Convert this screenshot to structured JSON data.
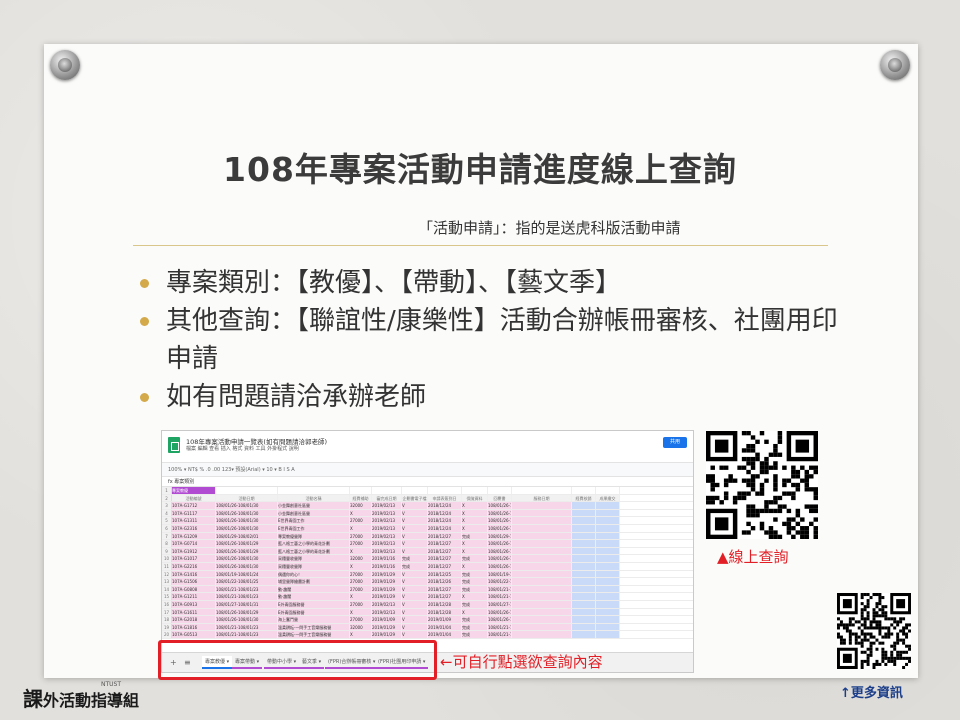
{
  "slide": {
    "title": "108年專案活動申請進度線上查詢",
    "subtitle": "「活動申請」：指的是送虎科版活動申請",
    "bullets": [
      "專案類別：【教優】、【帶動】、【藝文季】",
      "其他查詢：【聯誼性/康樂性】活動合辦帳冊審核、社團用印申請",
      "如有問題請洽承辦老師"
    ]
  },
  "spreadsheet": {
    "doc_title": "108年專案活動申請一覽表(如有問題請洽郭老師)",
    "menu": "檔案  編輯  查看  插入  格式  資料  工具  外掛程式  說明",
    "share_label": "共用",
    "toolbar": "100%  ▾  NT$  %  .0  .00  123▾  預設(Arial) ▾  10 ▾  B  I  S  A",
    "formula": "fx  專案類別",
    "tag": "專案教優",
    "header_row": [
      "活動編號",
      "活動日期",
      "活動名稱",
      "經費補助",
      "審完成日期",
      "企劃書電子檔",
      "申請表簽到日",
      "保險資料",
      "回覆書",
      "服務日期",
      "經費核銷",
      "成果繳交"
    ],
    "rows": [
      [
        "107A-G1712",
        "108/01/26-108/01/30",
        "小金舞創意社區營",
        "32000",
        "2019/02/13",
        "V",
        "2018/12/24",
        "X",
        "108/01/26-108/01/30"
      ],
      [
        "107A-G1117",
        "108/01/26-108/01/30",
        "小金舞創意社區營",
        "X",
        "2019/02/13",
        "V",
        "2018/12/24",
        "X",
        "108/01/26-108/01/30"
      ],
      [
        "107A-G1311",
        "108/01/26-108/01/30",
        "E世界青園工作",
        "27000",
        "2019/02/13",
        "V",
        "2018/12/24",
        "X",
        "108/01/26-108/01/30"
      ],
      [
        "107A-G2316",
        "108/01/26-108/01/30",
        "E世界青園工作",
        "X",
        "2019/02/13",
        "V",
        "2018/12/24",
        "X",
        "108/01/26-108/01/30"
      ],
      [
        "107A-G1209",
        "108/01/29-108/02/01",
        "專案教優營隊",
        "27000",
        "2019/02/13",
        "V",
        "2018/12/27",
        "完成",
        "108/01/29-108/02/01"
      ],
      [
        "107A-G0714",
        "108/01/26-108/01/29",
        "藍八格工藝之小學的青花計劃",
        "27000",
        "2019/02/13",
        "V",
        "2018/12/27",
        "X",
        "108/01/26-108/01/29"
      ],
      [
        "107A-G1912",
        "108/01/26-108/01/29",
        "藍八格工藝之小學的青花計劃",
        "X",
        "2019/02/13",
        "V",
        "2018/12/27",
        "X",
        "108/01/26-108/01/29"
      ],
      [
        "107A-G1017",
        "108/01/26-108/01/30",
        "采穗豐收營隊",
        "32000",
        "2019/01/16",
        "完成",
        "2018/12/27",
        "完成",
        "108/01/26-108/01/30"
      ],
      [
        "107A-G2216",
        "108/01/26-108/01/30",
        "采穗豐收營隊",
        "X",
        "2019/01/16",
        "完成",
        "2018/12/27",
        "X",
        "108/01/26-108/01/30"
      ],
      [
        "107A-G1416",
        "108/01/19-108/01/24",
        "偶遇你的心！",
        "27000",
        "2019/01/29",
        "V",
        "2018/12/25",
        "完成",
        "108/01/19-108/01/24"
      ],
      [
        "107A-G1506",
        "108/01/22-108/01/25",
        "埔里營隊繪畫計劃",
        "27000",
        "2019/01/29",
        "V",
        "2018/12/26",
        "完成",
        "108/01/22-108/01/25"
      ],
      [
        "107A-G0808",
        "108/01/21-108/01/23",
        "動‧趣閣",
        "27000",
        "2019/01/29",
        "V",
        "2018/12/27",
        "完成",
        "108/01/21-108/01/23"
      ],
      [
        "107A-G1211",
        "108/01/21-108/01/23",
        "動‧趣閣",
        "X",
        "2019/01/29",
        "V",
        "2018/12/27",
        "X",
        "108/01/21-108/01/23"
      ],
      [
        "107A-G0913",
        "108/01/27-108/01/31",
        "E外青園服務營",
        "27000",
        "2019/02/13",
        "V",
        "2018/12/28",
        "完成",
        "108/01/27-108/01/31"
      ],
      [
        "107A-G1611",
        "108/01/26-108/01/29",
        "E外青園服務營",
        "X",
        "2019/02/13",
        "V",
        "2018/12/28",
        "X",
        "108/01/26-108/01/29"
      ],
      [
        "107A-G2018",
        "108/01/26-108/01/30",
        "海上奮鬥營",
        "27000",
        "2019/01/09",
        "V",
        "2019/01/09",
        "完成",
        "108/01/26-108/01/30"
      ],
      [
        "107A-G1816",
        "108/01/21-108/01/23",
        "溫柔耕耘‧一閃手工音樂服務營",
        "32000",
        "2019/01/29",
        "V",
        "2019/01/04",
        "完成",
        "108/01/21-108/01/23"
      ],
      [
        "107A-G0513",
        "108/01/21-108/01/23",
        "溫柔耕耘‧一閃手工音樂服務營",
        "X",
        "2019/01/29",
        "V",
        "2019/01/04",
        "完成",
        "108/01/21-108/01/23"
      ]
    ],
    "tabs": [
      "專案教優",
      "專案帶動",
      "帶動中小學",
      "藝文季",
      "(FPR)合辦帳冊審核",
      "(FPR)社團用印申請"
    ]
  },
  "annotation": "←可自行點選欲查詢內容",
  "qr_label": "▲線上查詢",
  "more_info": "↑更多資訊",
  "logo": {
    "text_1": "課",
    "text_2": "外活動指導組",
    "superscript": "NTUST"
  },
  "colors": {
    "accent_red": "#e21f26",
    "bullet_gold": "#d3a94a",
    "link_blue": "#1d3f8a",
    "row_pink": "#f6d6e8",
    "col_blue": "#c9daf8"
  }
}
